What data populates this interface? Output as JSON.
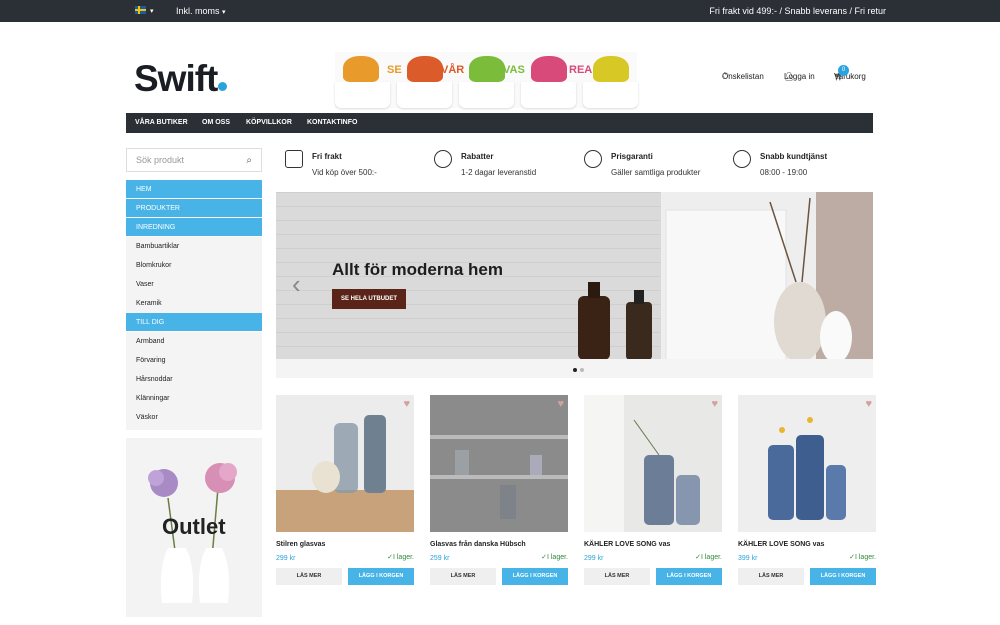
{
  "topbar": {
    "language_flag": "swedish-flag",
    "vat_label": "Inkl. moms",
    "shipping_info": "Fri frakt vid 499:- / Snabb leverans / Fri retur"
  },
  "logo": {
    "text": "Swift"
  },
  "banner": {
    "words": [
      "SE",
      "VÅR",
      "VAS",
      "REA"
    ]
  },
  "header": {
    "wishlist": "Önskelistan",
    "login": "Logga in",
    "cart": "Varukorg",
    "cart_count": "0"
  },
  "nav": {
    "items": [
      "VÅRA BUTIKER",
      "OM OSS",
      "KÖPVILLKOR",
      "KONTAKTINFO"
    ]
  },
  "search": {
    "placeholder": "Sök produkt"
  },
  "sidebar": {
    "items": [
      {
        "label": "HEM",
        "highlight": true
      },
      {
        "label": "PRODUKTER",
        "highlight": true
      },
      {
        "label": "INREDNING",
        "highlight": true
      },
      {
        "label": "Bambuartiklar",
        "highlight": false
      },
      {
        "label": "Blomkrukor",
        "highlight": false
      },
      {
        "label": "Vaser",
        "highlight": false
      },
      {
        "label": "Keramik",
        "highlight": false
      },
      {
        "label": "TILL DIG",
        "highlight": true
      },
      {
        "label": "Armband",
        "highlight": false
      },
      {
        "label": "Förvaring",
        "highlight": false
      },
      {
        "label": "Hårsnoddar",
        "highlight": false
      },
      {
        "label": "Klänningar",
        "highlight": false
      },
      {
        "label": "Väskor",
        "highlight": false
      }
    ]
  },
  "outlet": {
    "label": "Outlet"
  },
  "features": [
    {
      "title": "Fri frakt",
      "subtitle": "Vid köp över 500:-",
      "icon": "truck-icon"
    },
    {
      "title": "Rabatter",
      "subtitle": "1-2 dagar leveranstid",
      "icon": "percent-icon"
    },
    {
      "title": "Prisgaranti",
      "subtitle": "Gäller samtliga produkter",
      "icon": "money-icon"
    },
    {
      "title": "Snabb kundtjänst",
      "subtitle": "08:00 - 19:00",
      "icon": "support-icon"
    }
  ],
  "hero": {
    "title": "Allt för moderna hem",
    "cta": "SE HELA UTBUDET"
  },
  "products": [
    {
      "name": "Stilren glasvas",
      "price": "299 kr",
      "stock": "I lager.",
      "more": "LÄS MER",
      "buy": "LÄGG I KORGEN"
    },
    {
      "name": "Glasvas från danska Hübsch",
      "price": "259 kr",
      "stock": "I lager.",
      "more": "LÄS MER",
      "buy": "LÄGG I KORGEN"
    },
    {
      "name": "KÄHLER LOVE SONG vas",
      "price": "299 kr",
      "stock": "I lager.",
      "more": "LÄS MER",
      "buy": "LÄGG I KORGEN"
    },
    {
      "name": "KÄHLER LOVE SONG vas",
      "price": "399 kr",
      "stock": "I lager.",
      "more": "LÄS MER",
      "buy": "LÄGG I KORGEN"
    }
  ],
  "colors": {
    "accent": "#48b3e6",
    "dark": "#2b2f36",
    "cta": "#5a2418"
  }
}
